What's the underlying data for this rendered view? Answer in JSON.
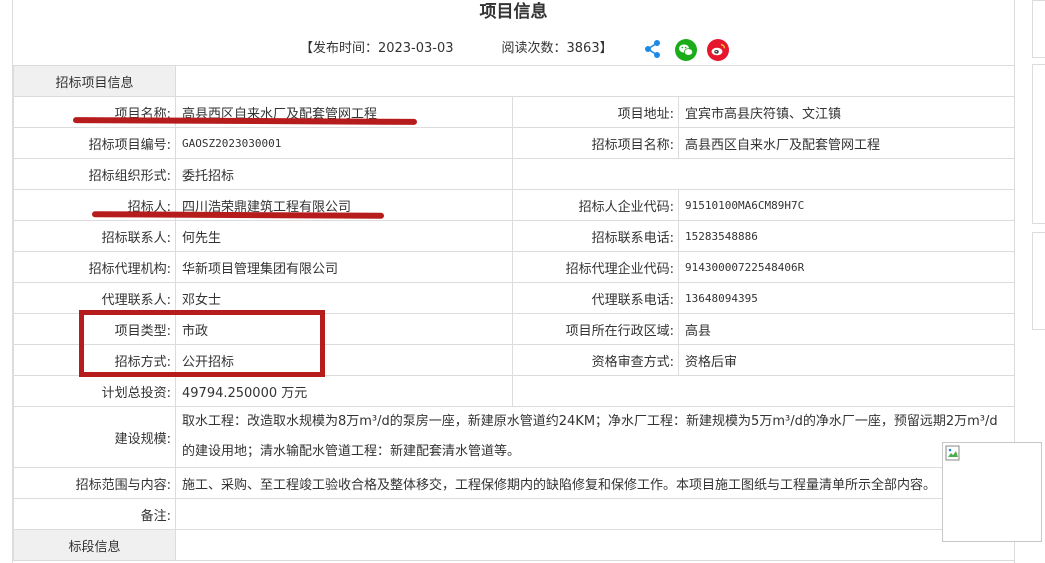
{
  "header": {
    "title": "项目信息",
    "publish_label": "【发布时间：2023-03-03",
    "read_label": "阅读次数：3863】"
  },
  "icons": {
    "share": "share-icon",
    "wechat": "wechat-icon",
    "weibo": "weibo-icon"
  },
  "colors": {
    "wechat": "#1aad19",
    "weibo": "#e6162d",
    "share": "#1e88e5",
    "annotation": "#b71c1c"
  },
  "sections": {
    "project": "招标项目信息",
    "lots": "标段信息"
  },
  "fields": {
    "project_name_label": "项目名称:",
    "project_name": "高县西区自来水厂及配套管网工程",
    "project_address_label": "项目地址:",
    "project_address": "宜宾市高县庆符镇、文江镇",
    "project_code_label": "招标项目编号:",
    "project_code": "GAOSZ2023030001",
    "tender_project_name_label": "招标项目名称:",
    "tender_project_name": "高县西区自来水厂及配套管网工程",
    "org_form_label": "招标组织形式:",
    "org_form": "委托招标",
    "tenderer_label": "招标人:",
    "tenderer": "四川浩荣鼎建筑工程有限公司",
    "tenderer_code_label": "招标人企业代码:",
    "tenderer_code": "91510100MA6CM89H7C",
    "contact_label": "招标联系人:",
    "contact": "何先生",
    "contact_phone_label": "招标联系电话:",
    "contact_phone": "15283548886",
    "agency_label": "招标代理机构:",
    "agency": "华新项目管理集团有限公司",
    "agency_code_label": "招标代理企业代码:",
    "agency_code": "91430000722548406R",
    "agent_contact_label": "代理联系人:",
    "agent_contact": "邓女士",
    "agent_phone_label": "代理联系电话:",
    "agent_phone": "13648094395",
    "project_type_label": "项目类型:",
    "project_type": "市政",
    "region_label": "项目所在行政区域:",
    "region": "高县",
    "tender_method_label": "招标方式:",
    "tender_method": "公开招标",
    "qualification_label": "资格审查方式:",
    "qualification": "资格后审",
    "investment_label": "计划总投资:",
    "investment": "49794.250000 万元",
    "scale_label": "建设规模:",
    "scale": "取水工程：改造取水规模为8万m³/d的泵房一座，新建原水管道约24KM；净水厂工程：新建规模为5万m³/d的净水厂一座，预留远期2万m³/d的建设用地；清水输配水管道工程：新建配套清水管道等。",
    "scope_label": "招标范围与内容:",
    "scope": "施工、采购、至工程竣工验收合格及整体移交，工程保修期内的缺陷修复和保修工作。本项目施工图纸与工程量清单所示全部内容。",
    "remark_label": "备注:",
    "remark": ""
  }
}
